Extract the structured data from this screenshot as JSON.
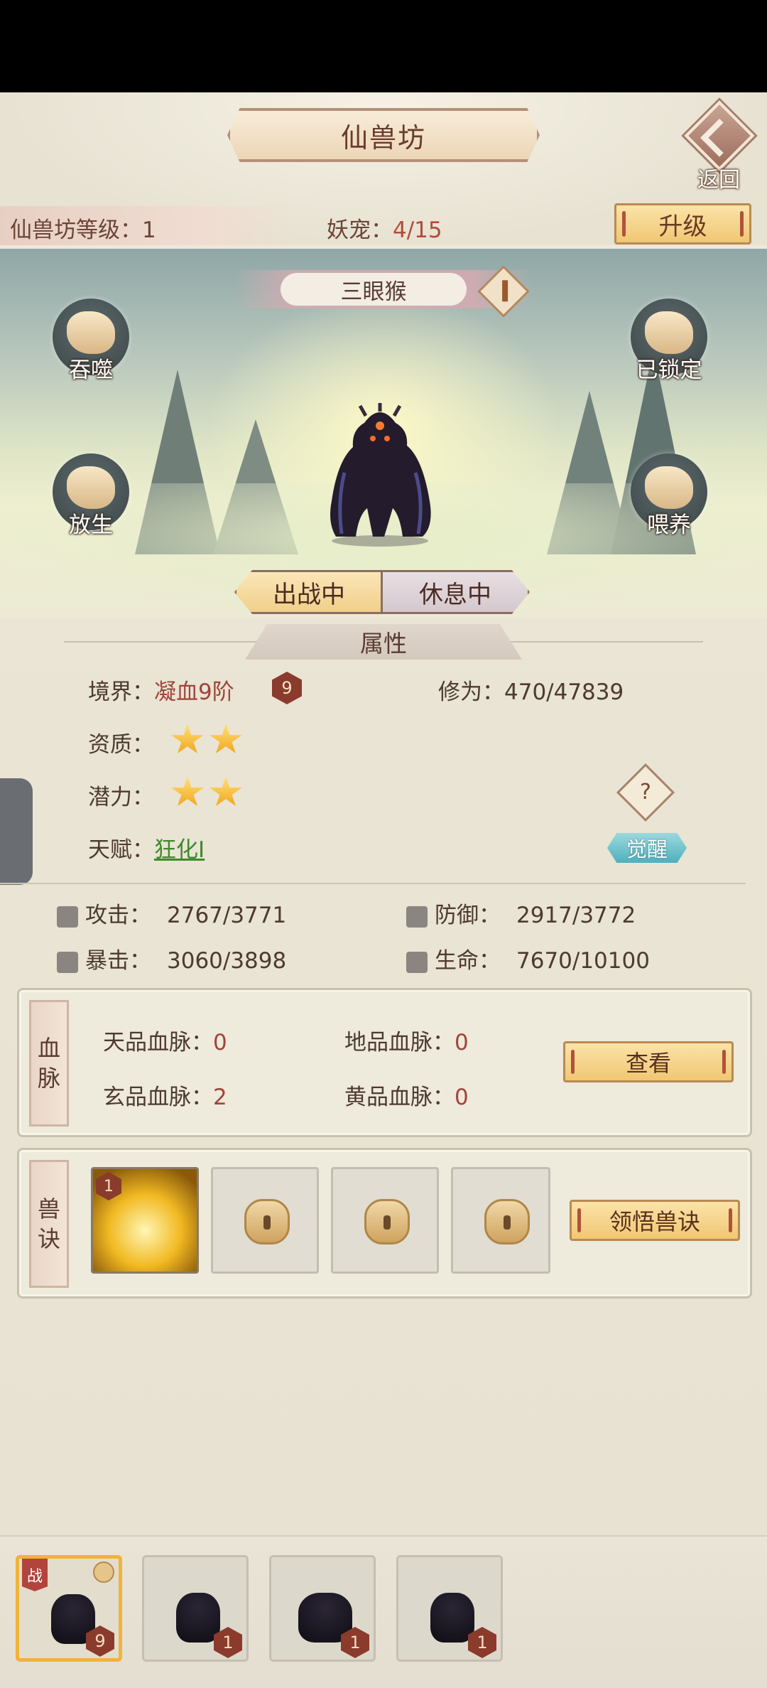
{
  "header": {
    "title": "仙兽坊",
    "back_label": "返回"
  },
  "level_bar": {
    "level_label": "仙兽坊等级：",
    "level_value": "1",
    "pet_label": "妖宠：",
    "pet_value": "4/15",
    "upgrade_label": "升级"
  },
  "pet": {
    "name": "三眼猴"
  },
  "actions": {
    "devour": "吞噬",
    "locked": "已锁定",
    "release": "放生",
    "feed": "喂养"
  },
  "status": {
    "active": "出战中",
    "resting": "休息中"
  },
  "attributes": {
    "header": "属性",
    "realm_label": "境界：",
    "realm_value": "凝血9阶",
    "realm_badge": "9",
    "cultivation_label": "修为：",
    "cultivation_value": "470/47839",
    "aptitude_label": "资质：",
    "aptitude_stars": 2,
    "potential_label": "潜力：",
    "potential_stars": 2,
    "talent_label": "天赋：",
    "talent_value": "狂化I",
    "help_glyph": "?",
    "awaken_label": "觉醒"
  },
  "stats": {
    "attack_label": "攻击：",
    "attack_value": "2767/3771",
    "defense_label": "防御：",
    "defense_value": "2917/3772",
    "crit_label": "暴击：",
    "crit_value": "3060/3898",
    "hp_label": "生命：",
    "hp_value": "7670/10100"
  },
  "bloodline": {
    "title_1": "血",
    "title_2": "脉",
    "heaven_label": "天品血脉：",
    "heaven_value": "0",
    "earth_label": "地品血脉：",
    "earth_value": "0",
    "mystic_label": "玄品血脉：",
    "mystic_value": "2",
    "yellow_label": "黄品血脉：",
    "yellow_value": "0",
    "view_label": "查看"
  },
  "skills": {
    "title_1": "兽",
    "title_2": "诀",
    "active_level": "1",
    "learn_label": "领悟兽诀"
  },
  "roster": [
    {
      "level": "9",
      "tag": "战"
    },
    {
      "level": "1"
    },
    {
      "level": "1"
    },
    {
      "level": "1"
    }
  ],
  "colors": {
    "accent_gold": "#f0c774",
    "badge_brown": "#8a3b2c",
    "highlight_red": "#a1443a",
    "talent_green": "#3f8a2e"
  }
}
